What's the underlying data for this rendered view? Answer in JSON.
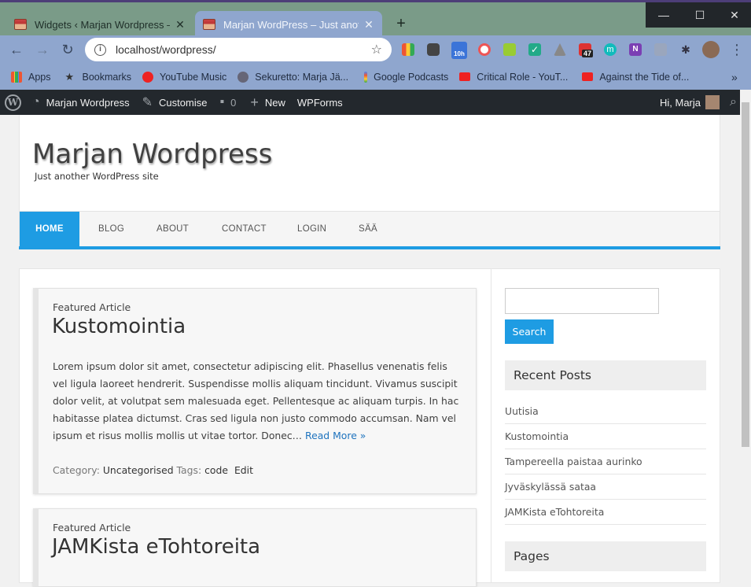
{
  "browser": {
    "tabs": [
      {
        "title": "Widgets ‹ Marjan Wordpress — W",
        "active": false
      },
      {
        "title": "Marjan WordPress – Just another",
        "active": true
      }
    ],
    "url": "localhost/wordpress/",
    "extension_badges": {
      "calendar": "10h",
      "todoist": "47"
    },
    "bookmarks": [
      "Apps",
      "Bookmarks",
      "YouTube Music",
      "Sekuretto: Marja Jä...",
      "Google Podcasts",
      "Critical Role - YouT...",
      "Against the Tide of..."
    ]
  },
  "adminbar": {
    "site": "Marjan Wordpress",
    "customise": "Customise",
    "comments": "0",
    "new": "New",
    "wpforms": "WPForms",
    "greeting": "Hi, Marja"
  },
  "site": {
    "title": "Marjan Wordpress",
    "tagline": "Just another WordPress site"
  },
  "nav": [
    "HOME",
    "BLOG",
    "ABOUT",
    "CONTACT",
    "LOGIN",
    "SÄÄ"
  ],
  "posts": [
    {
      "kicker": "Featured Article",
      "title": "Kustomointia",
      "excerpt": "Lorem ipsum dolor sit amet, consectetur adipiscing elit. Phasellus venenatis felis vel ligula laoreet hendrerit. Suspendisse mollis aliquam tincidunt. Vivamus suscipit dolor velit, at volutpat sem malesuada eget. Pellentesque ac aliquam turpis. In hac habitasse platea dictumst. Cras sed ligula non justo commodo accumsan. Nam vel ipsum et risus mollis mollis ut vitae tortor. Donec…",
      "read_more": "Read More »",
      "category_label": "Category:",
      "category": "Uncategorised",
      "tags_label": "Tags:",
      "tag": "code",
      "edit": "Edit"
    },
    {
      "kicker": "Featured Article",
      "title": "JAMKista eTohtoreita"
    }
  ],
  "sidebar": {
    "search_button": "Search",
    "recent_posts_title": "Recent Posts",
    "recent_posts": [
      "Uutisia",
      "Kustomointia",
      "Tampereella paistaa aurinko",
      "Jyväskylässä sataa",
      "JAMKista eTohtoreita"
    ],
    "pages_title": "Pages"
  },
  "colors": {
    "accent": "#1e9ce3",
    "adminbar": "#23282d",
    "tab_strip": "#7a9b88",
    "toolbar": "#8fa6ce"
  }
}
